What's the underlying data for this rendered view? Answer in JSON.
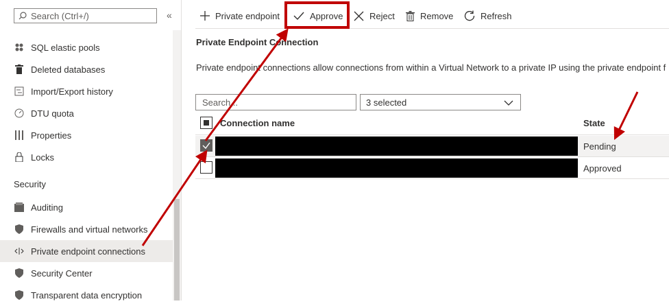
{
  "sidebar": {
    "search_placeholder": "Search (Ctrl+/)",
    "collapse_glyph": "«",
    "items": [
      {
        "label": "SQL elastic pools",
        "icon": "elastic-pool-icon"
      },
      {
        "label": "Deleted databases",
        "icon": "trash-icon"
      },
      {
        "label": "Import/Export history",
        "icon": "import-export-icon"
      },
      {
        "label": "DTU quota",
        "icon": "gauge-icon"
      },
      {
        "label": "Properties",
        "icon": "properties-icon"
      },
      {
        "label": "Locks",
        "icon": "lock-icon"
      }
    ],
    "section": "Security",
    "security_items": [
      {
        "label": "Auditing",
        "icon": "auditing-icon"
      },
      {
        "label": "Firewalls and virtual networks",
        "icon": "shield-icon"
      },
      {
        "label": "Private endpoint connections",
        "icon": "private-endpoint-icon",
        "selected": true
      },
      {
        "label": "Security Center",
        "icon": "shield-icon"
      },
      {
        "label": "Transparent data encryption",
        "icon": "shield-icon"
      }
    ]
  },
  "toolbar": {
    "add_label": "Private endpoint",
    "approve_label": "Approve",
    "reject_label": "Reject",
    "remove_label": "Remove",
    "refresh_label": "Refresh"
  },
  "main": {
    "title": "Private Endpoint Connection",
    "description": "Private endpoint connections allow connections from within a Virtual Network to a private IP using the private endpoint f",
    "filter_placeholder": "Search...",
    "state_filter": "3 selected",
    "columns": {
      "name": "Connection name",
      "state": "State"
    },
    "rows": [
      {
        "state": "Pending",
        "checked": true
      },
      {
        "state": "Approved",
        "checked": false
      }
    ]
  },
  "colors": {
    "annotation": "#c00000",
    "selected_row": "#f3f2f1"
  }
}
